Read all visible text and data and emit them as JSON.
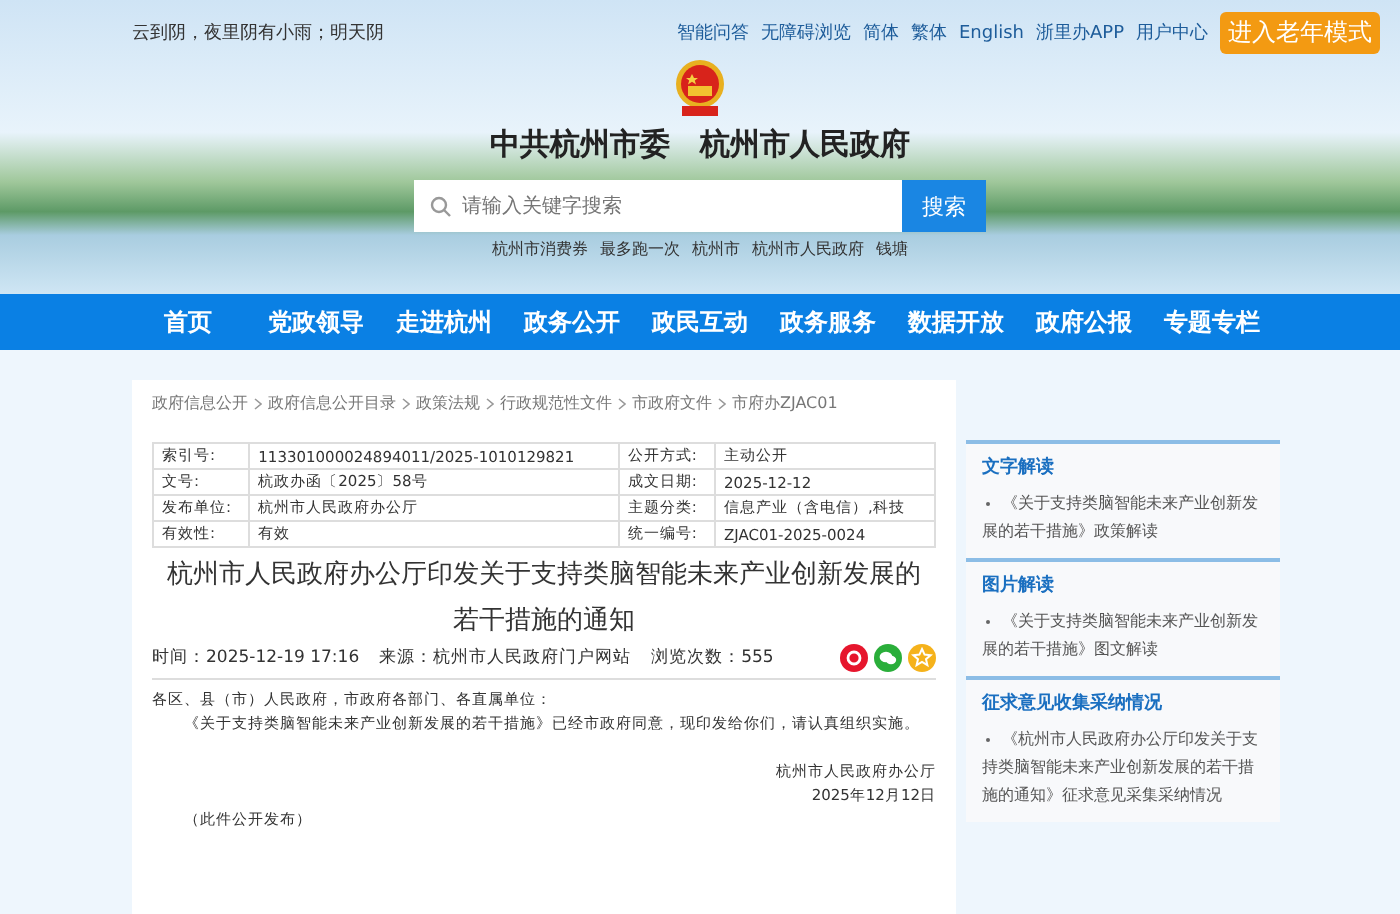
{
  "top_bar": {
    "weather": "云到阴，夜里阴有小雨；明天阴",
    "links": [
      "智能问答",
      "无障碍浏览",
      "简体",
      "繁体",
      "English",
      "浙里办APP",
      "用户中心"
    ],
    "elder_mode": "进入老年模式"
  },
  "header": {
    "site_title": "中共杭州市委　杭州市人民政府",
    "search": {
      "placeholder": "请输入关键字搜索",
      "button": "搜索"
    },
    "hot_words": [
      "杭州市消费券",
      "最多跑一次",
      "杭州市",
      "杭州市人民政府",
      "钱塘"
    ]
  },
  "nav": {
    "items": [
      {
        "label": "首页",
        "selected": false
      },
      {
        "label": "党政领导",
        "selected": false
      },
      {
        "label": "走进杭州",
        "selected": false
      },
      {
        "label": "政务公开",
        "selected": false
      },
      {
        "label": "政民互动",
        "selected": false
      },
      {
        "label": "政务服务",
        "selected": false
      },
      {
        "label": "数据开放",
        "selected": false
      },
      {
        "label": "政府公报",
        "selected": false
      },
      {
        "label": "专题专栏",
        "selected": false
      }
    ]
  },
  "breadcrumb": [
    "政府信息公开",
    "政府信息公开目录",
    "政策法规",
    "行政规范性文件",
    "市政府文件",
    "市府办ZJAC01"
  ],
  "info_table": {
    "rows": [
      {
        "label_1": "索引号:",
        "value_1": "113301000024894011/2025-1010129821",
        "label_2": "公开方式:",
        "value_2": "主动公开"
      },
      {
        "label_1": "文号:",
        "value_1": "杭政办函〔2025〕58号",
        "label_2": "成文日期:",
        "value_2": "2025-12-12"
      },
      {
        "label_1": "发布单位:",
        "value_1": "杭州市人民政府办公厅",
        "label_2": "主题分类:",
        "value_2": "信息产业（含电信）,科技"
      },
      {
        "label_1": "有效性:",
        "value_1": "有效",
        "label_2": "统一编号:",
        "value_2": "ZJAC01-2025-0024"
      }
    ]
  },
  "article": {
    "title_lines": [
      "杭州市人民政府办公厅印发关于支持类脑智能未来产业创新发展的",
      "若干措施的通知"
    ],
    "meta": [
      "时间：2025-12-19 17:16",
      "来源：杭州市人民政府门户网站",
      "浏览次数：555"
    ],
    "share": [
      {
        "kind": "weibo",
        "color": "#e6162d"
      },
      {
        "kind": "wechat",
        "color": "#2aae3a"
      },
      {
        "kind": "favorite",
        "color": "#f5b21b"
      }
    ],
    "salutation": "各区、县（市）人民政府，市政府各部门、各直属单位：",
    "body": "《关于支持类脑智能未来产业创新发展的若干措施》已经市政府同意，现印发给你们，请认真组织实施。",
    "signature": "杭州市人民政府办公厅",
    "date": "2025年12月12日",
    "note": "（此件公开发布）"
  },
  "sidebar": {
    "sections": [
      {
        "title": "文字解读",
        "items": [
          "《关于支持类脑智能未来产业创新发展的若干措施》政策解读"
        ]
      },
      {
        "title": "图片解读",
        "items": [
          "《关于支持类脑智能未来产业创新发展的若干措施》图文解读"
        ]
      },
      {
        "title": "征求意见收集采纳情况",
        "items": [
          "《杭州市人民政府办公厅印发关于支持类脑智能未来产业创新发展的若干措施的通知》征求意见采集采纳情况"
        ]
      }
    ]
  }
}
